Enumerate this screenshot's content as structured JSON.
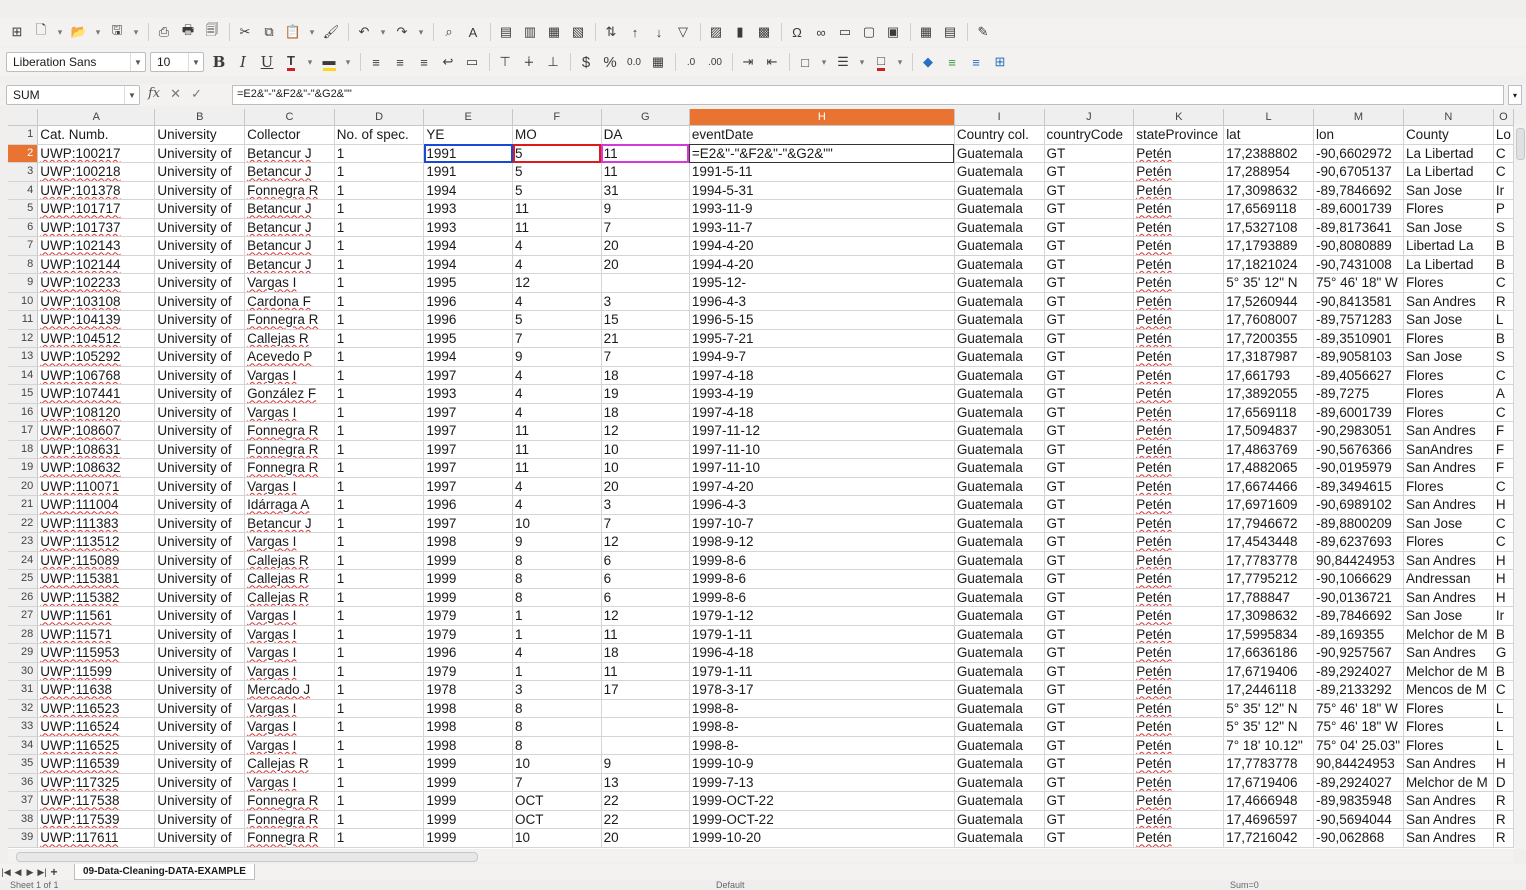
{
  "toolbar1": {
    "icons": [
      "table-grid-icon",
      "new-document-icon",
      "open-folder-icon",
      "save-icon",
      "export-pdf-icon",
      "print-icon",
      "print-preview-icon",
      "cut-icon",
      "copy-icon",
      "paste-icon",
      "clone-format-icon",
      "undo-icon",
      "redo-icon",
      "find-replace-icon",
      "spelling-icon",
      "row-insert-icon",
      "column-insert-icon",
      "row-delete-icon",
      "column-delete-icon",
      "sort-icon",
      "sort-ascending-icon",
      "sort-descending-icon",
      "autofilter-icon",
      "image-icon",
      "chart-icon",
      "pivot-table-icon",
      "special-character-icon",
      "hyperlink-icon",
      "comment-icon",
      "header-footer-icon",
      "define-print-area-icon",
      "freeze-rows-icon",
      "split-window-icon",
      "show-draw-functions-icon"
    ]
  },
  "toolbar2": {
    "font_name": "Liberation Sans",
    "font_size": "10",
    "bold": "B",
    "italic": "I",
    "underline": "U",
    "currency": "$",
    "percent": "%",
    "number_format": "0.0"
  },
  "formula": {
    "name_box": "SUM",
    "fx": "fx",
    "cancel": "✕",
    "accept": "✓",
    "content": "=E2&\"-\"&F2&\"-\"&G2&\"\""
  },
  "grid": {
    "columns": [
      "A",
      "B",
      "C",
      "D",
      "E",
      "F",
      "G",
      "H",
      "I",
      "J",
      "K",
      "L",
      "M",
      "N",
      "O"
    ],
    "active_column": "H",
    "active_row": "2",
    "rows": [
      {
        "n": "1",
        "c": [
          "Cat. Numb.",
          "University",
          "Collector",
          "No. of spec.",
          "YE",
          "MO",
          "DA",
          "eventDate",
          "Country col.",
          "countryCode",
          "stateProvince",
          "lat",
          "lon",
          "County",
          "Lo"
        ]
      },
      {
        "n": "2",
        "c": [
          "UWP:100217",
          "University of",
          "Betancur J",
          "1",
          "1991",
          "5",
          "11",
          "",
          "Guatemala",
          "GT",
          "Petén",
          "17,2388802",
          "-90,6602972",
          "La Libertad",
          "C"
        ]
      },
      {
        "n": "3",
        "c": [
          "UWP:100218",
          "University of",
          "Betancur J",
          "1",
          "1991",
          "5",
          "11",
          "1991-5-11",
          "Guatemala",
          "GT",
          "Petén",
          "17,288954",
          "-90,6705137",
          "La Libertad",
          "C"
        ]
      },
      {
        "n": "4",
        "c": [
          "UWP:101378",
          "University of",
          "Fonnegra R",
          "1",
          "1994",
          "5",
          "31",
          "1994-5-31",
          "Guatemala",
          "GT",
          "Petén",
          "17,3098632",
          "-89,7846692",
          "San Jose",
          "Ir"
        ]
      },
      {
        "n": "5",
        "c": [
          "UWP:101717",
          "University of",
          "Betancur J",
          "1",
          "1993",
          "11",
          "9",
          "1993-11-9",
          "Guatemala",
          "GT",
          "Petén",
          "17,6569118",
          "-89,6001739",
          "Flores",
          "P"
        ]
      },
      {
        "n": "6",
        "c": [
          "UWP:101737",
          "University of",
          "Betancur J",
          "1",
          "1993",
          "11",
          "7",
          "1993-11-7",
          "Guatemala",
          "GT",
          "Petén",
          "17,5327108",
          "-89,8173641",
          "San Jose",
          "S"
        ]
      },
      {
        "n": "7",
        "c": [
          "UWP:102143",
          "University of",
          "Betancur J",
          "1",
          "1994",
          "4",
          "20",
          "1994-4-20",
          "Guatemala",
          "GT",
          "Petén",
          "17,1793889",
          "-90,8080889",
          "Libertad La",
          "B"
        ]
      },
      {
        "n": "8",
        "c": [
          "UWP:102144",
          "University of",
          "Betancur J",
          "1",
          "1994",
          "4",
          "20",
          "1994-4-20",
          "Guatemala",
          "GT",
          "Petén",
          "17,1821024",
          "-90,7431008",
          "La Libertad",
          "B"
        ]
      },
      {
        "n": "9",
        "c": [
          "UWP:102233",
          "University of",
          "Vargas I",
          "1",
          "1995",
          "12",
          "",
          "1995-12-",
          "Guatemala",
          "GT",
          "Petén",
          "5° 35' 12\" N",
          "75° 46' 18\" W",
          "Flores",
          "C"
        ]
      },
      {
        "n": "10",
        "c": [
          "UWP:103108",
          "University of",
          "Cardona F",
          "1",
          "1996",
          "4",
          "3",
          "1996-4-3",
          "Guatemala",
          "GT",
          "Petén",
          "17,5260944",
          "-90,8413581",
          "San Andres",
          "R"
        ]
      },
      {
        "n": "11",
        "c": [
          "UWP:104139",
          "University of",
          "Fonnegra R",
          "1",
          "1996",
          "5",
          "15",
          "1996-5-15",
          "Guatemala",
          "GT",
          "Petén",
          "17,7608007",
          "-89,7571283",
          "San Jose",
          "L"
        ]
      },
      {
        "n": "12",
        "c": [
          "UWP:104512",
          "University of",
          "Callejas R",
          "1",
          "1995",
          "7",
          "21",
          "1995-7-21",
          "Guatemala",
          "GT",
          "Petén",
          "17,7200355",
          "-89,3510901",
          "Flores",
          "B"
        ]
      },
      {
        "n": "13",
        "c": [
          "UWP:105292",
          "University of",
          "Acevedo P",
          "1",
          "1994",
          "9",
          "7",
          "1994-9-7",
          "Guatemala",
          "GT",
          "Petén",
          "17,3187987",
          "-89,9058103",
          "San Jose",
          "S"
        ]
      },
      {
        "n": "14",
        "c": [
          "UWP:106768",
          "University of",
          "Vargas I",
          "1",
          "1997",
          "4",
          "18",
          "1997-4-18",
          "Guatemala",
          "GT",
          "Petén",
          "17,661793",
          "-89,4056627",
          "Flores",
          "C"
        ]
      },
      {
        "n": "15",
        "c": [
          "UWP:107441",
          "University of",
          "González F",
          "1",
          "1993",
          "4",
          "19",
          "1993-4-19",
          "Guatemala",
          "GT",
          "Petén",
          "17,3892055",
          "-89,7275",
          "Flores",
          "A"
        ]
      },
      {
        "n": "16",
        "c": [
          "UWP:108120",
          "University of",
          "Vargas I",
          "1",
          "1997",
          "4",
          "18",
          "1997-4-18",
          "Guatemala",
          "GT",
          "Petén",
          "17,6569118",
          "-89,6001739",
          "Flores",
          "C"
        ]
      },
      {
        "n": "17",
        "c": [
          "UWP:108607",
          "University of",
          "Fonnegra R",
          "1",
          "1997",
          "11",
          "12",
          "1997-11-12",
          "Guatemala",
          "GT",
          "Petén",
          "17,5094837",
          "-90,2983051",
          "San Andres",
          "F"
        ]
      },
      {
        "n": "18",
        "c": [
          "UWP:108631",
          "University of",
          "Fonnegra R",
          "1",
          "1997",
          "11",
          "10",
          "1997-11-10",
          "Guatemala",
          "GT",
          "Petén",
          "17,4863769",
          "-90,5676366",
          "SanAndres",
          "F"
        ]
      },
      {
        "n": "19",
        "c": [
          "UWP:108632",
          "University of",
          "Fonnegra R",
          "1",
          "1997",
          "11",
          "10",
          "1997-11-10",
          "Guatemala",
          "GT",
          "Petén",
          "17,4882065",
          "-90,0195979",
          "San Andres",
          "F"
        ]
      },
      {
        "n": "20",
        "c": [
          "UWP:110071",
          "University of",
          "Vargas I",
          "1",
          "1997",
          "4",
          "20",
          "1997-4-20",
          "Guatemala",
          "GT",
          "Petén",
          "17,6674466",
          "-89,3494615",
          "Flores",
          "C"
        ]
      },
      {
        "n": "21",
        "c": [
          "UWP:111004",
          "University of",
          "Idárraga A",
          "1",
          "1996",
          "4",
          "3",
          "1996-4-3",
          "Guatemala",
          "GT",
          "Petén",
          "17,6971609",
          "-90,6989102",
          "San Andres",
          "H"
        ]
      },
      {
        "n": "22",
        "c": [
          "UWP:111383",
          "University of",
          "Betancur J",
          "1",
          "1997",
          "10",
          "7",
          "1997-10-7",
          "Guatemala",
          "GT",
          "Petén",
          "17,7946672",
          "-89,8800209",
          "San Jose",
          "C"
        ]
      },
      {
        "n": "23",
        "c": [
          "UWP:113512",
          "University of",
          "Vargas I",
          "1",
          "1998",
          "9",
          "12",
          "1998-9-12",
          "Guatemala",
          "GT",
          "Petén",
          "17,4543448",
          "-89,6237693",
          "Flores",
          "C"
        ]
      },
      {
        "n": "24",
        "c": [
          "UWP:115089",
          "University of",
          "Callejas R",
          "1",
          "1999",
          "8",
          "6",
          "1999-8-6",
          "Guatemala",
          "GT",
          "Petén",
          "17,7783778",
          "90,84424953",
          "San Andres",
          "H"
        ]
      },
      {
        "n": "25",
        "c": [
          "UWP:115381",
          "University of",
          "Callejas R",
          "1",
          "1999",
          "8",
          "6",
          "1999-8-6",
          "Guatemala",
          "GT",
          "Petén",
          "17,7795212",
          "-90,1066629",
          "Andressan",
          "H"
        ]
      },
      {
        "n": "26",
        "c": [
          "UWP:115382",
          "University of",
          "Callejas R",
          "1",
          "1999",
          "8",
          "6",
          "1999-8-6",
          "Guatemala",
          "GT",
          "Petén",
          "17,788847",
          "-90,0136721",
          "San Andres",
          "H"
        ]
      },
      {
        "n": "27",
        "c": [
          "UWP:11561",
          "University of",
          "Vargas I",
          "1",
          "1979",
          "1",
          "12",
          "1979-1-12",
          "Guatemala",
          "GT",
          "Petén",
          "17,3098632",
          "-89,7846692",
          "San Jose",
          "Ir"
        ]
      },
      {
        "n": "28",
        "c": [
          "UWP:11571",
          "University of",
          "Vargas I",
          "1",
          "1979",
          "1",
          "11",
          "1979-1-11",
          "Guatemala",
          "GT",
          "Petén",
          "17,5995834",
          "-89,169355",
          "Melchor de M",
          "B"
        ]
      },
      {
        "n": "29",
        "c": [
          "UWP:115953",
          "University of",
          "Vargas I",
          "1",
          "1996",
          "4",
          "18",
          "1996-4-18",
          "Guatemala",
          "GT",
          "Petén",
          "17,6636186",
          "-90,9257567",
          "San Andres",
          "G"
        ]
      },
      {
        "n": "30",
        "c": [
          "UWP:11599",
          "University of",
          "Vargas I",
          "1",
          "1979",
          "1",
          "11",
          "1979-1-11",
          "Guatemala",
          "GT",
          "Petén",
          "17,6719406",
          "-89,2924027",
          "Melchor de M",
          "B"
        ]
      },
      {
        "n": "31",
        "c": [
          "UWP:11638",
          "University of",
          "Mercado J",
          "1",
          "1978",
          "3",
          "17",
          "1978-3-17",
          "Guatemala",
          "GT",
          "Petén",
          "17,2446118",
          "-89,2133292",
          "Mencos de M",
          "C"
        ]
      },
      {
        "n": "32",
        "c": [
          "UWP:116523",
          "University of",
          "Vargas I",
          "1",
          "1998",
          "8",
          "",
          "1998-8-",
          "Guatemala",
          "GT",
          "Petén",
          "5° 35' 12\" N",
          "75° 46' 18\" W",
          "Flores",
          "L"
        ]
      },
      {
        "n": "33",
        "c": [
          "UWP:116524",
          "University of",
          "Vargas I",
          "1",
          "1998",
          "8",
          "",
          "1998-8-",
          "Guatemala",
          "GT",
          "Petén",
          "5° 35' 12\" N",
          "75° 46' 18\" W",
          "Flores",
          "L"
        ]
      },
      {
        "n": "34",
        "c": [
          "UWP:116525",
          "University of",
          "Vargas I",
          "1",
          "1998",
          "8",
          "",
          "1998-8-",
          "Guatemala",
          "GT",
          "Petén",
          "7° 18' 10.12\"",
          "75° 04' 25.03\"",
          "Flores",
          "L"
        ]
      },
      {
        "n": "35",
        "c": [
          "UWP:116539",
          "University of",
          "Callejas R",
          "1",
          "1999",
          "10",
          "9",
          "1999-10-9",
          "Guatemala",
          "GT",
          "Petén",
          "17,7783778",
          "90,84424953",
          "San Andres",
          "H"
        ]
      },
      {
        "n": "36",
        "c": [
          "UWP:117325",
          "University of",
          "Vargas I",
          "1",
          "1999",
          "7",
          "13",
          "1999-7-13",
          "Guatemala",
          "GT",
          "Petén",
          "17,6719406",
          "-89,2924027",
          "Melchor de M",
          "D"
        ]
      },
      {
        "n": "37",
        "c": [
          "UWP:117538",
          "University of",
          "Fonnegra R",
          "1",
          "1999",
          "OCT",
          "22",
          "1999-OCT-22",
          "Guatemala",
          "GT",
          "Petén",
          "17,4666948",
          "-89,9835948",
          "San Andres",
          "R"
        ]
      },
      {
        "n": "38",
        "c": [
          "UWP:117539",
          "University of",
          "Fonnegra R",
          "1",
          "1999",
          "OCT",
          "22",
          "1999-OCT-22",
          "Guatemala",
          "GT",
          "Petén",
          "17,4696597",
          "-90,5694044",
          "San Andres",
          "R"
        ]
      },
      {
        "n": "39",
        "c": [
          "UWP:117611",
          "University of",
          "Fonnegra R",
          "1",
          "1999",
          "10",
          "20",
          "1999-10-20",
          "Guatemala",
          "GT",
          "Petén",
          "17,7216042",
          "-90,062868",
          "San Andres",
          "R"
        ]
      }
    ]
  },
  "sheet_tab": "09-Data-Cleaning-DATA-EXAMPLE",
  "status": {
    "sheet": "Sheet 1 of 1",
    "style": "Default",
    "sum": "Sum=0"
  },
  "colors": {
    "accent": "#e97330",
    "ref_e": "#1a49d6",
    "ref_f": "#e0191d",
    "ref_g": "#c93ad0"
  }
}
